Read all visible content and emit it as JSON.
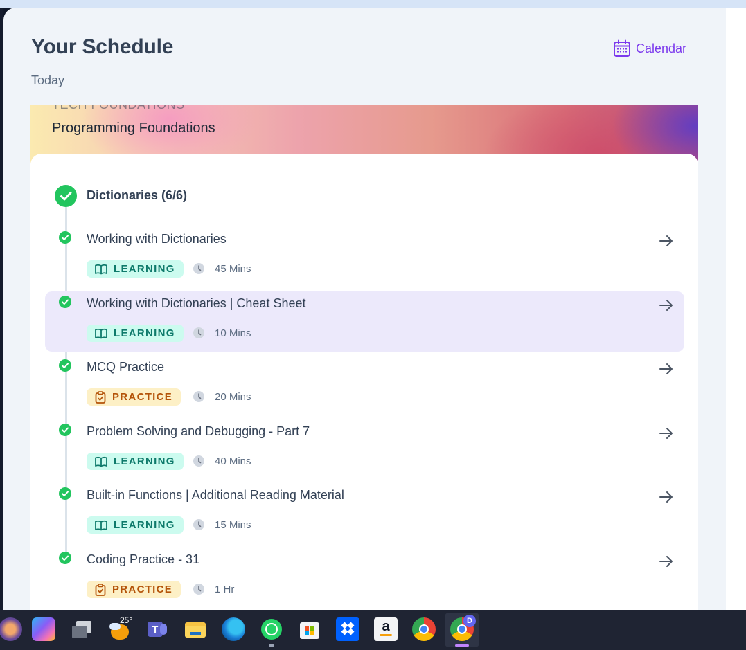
{
  "header": {
    "title": "Your Schedule",
    "subtitle": "Today",
    "calendar_label": "Calendar"
  },
  "banner": {
    "pre_title": "TECH FOUNDATIONS",
    "title": "Programming Foundations"
  },
  "module": {
    "title": "Dictionaries (6/6)"
  },
  "items": [
    {
      "title": "Working with Dictionaries",
      "type": "LEARNING",
      "duration": "45 Mins"
    },
    {
      "title": "Working with Dictionaries | Cheat Sheet",
      "type": "LEARNING",
      "duration": "10 Mins"
    },
    {
      "title": "MCQ Practice",
      "type": "PRACTICE",
      "duration": "20 Mins"
    },
    {
      "title": "Problem Solving and Debugging - Part 7",
      "type": "LEARNING",
      "duration": "40 Mins"
    },
    {
      "title": "Built-in Functions | Additional Reading Material",
      "type": "LEARNING",
      "duration": "15 Mins"
    },
    {
      "title": "Coding Practice - 31",
      "type": "PRACTICE",
      "duration": "1 Hr"
    }
  ],
  "taskbar": {
    "weather_temp": "25°",
    "chrome_profile_badge": "D",
    "apps": [
      "app-icon",
      "copilot-icon",
      "task-view-icon",
      "weather-icon",
      "teams-icon",
      "file-explorer-icon",
      "edge-icon",
      "whatsapp-icon",
      "store-icon",
      "dropbox-icon",
      "amazon-icon",
      "chrome-icon",
      "chrome-profile-icon"
    ]
  },
  "colors": {
    "accent": "#7c3aed",
    "success": "#22c55e",
    "active_row": "#ece9fb",
    "learning_bg": "#ccfbef",
    "learning_text": "#0e7a6b",
    "practice_bg": "#fdf0c6",
    "practice_text": "#b45309"
  }
}
